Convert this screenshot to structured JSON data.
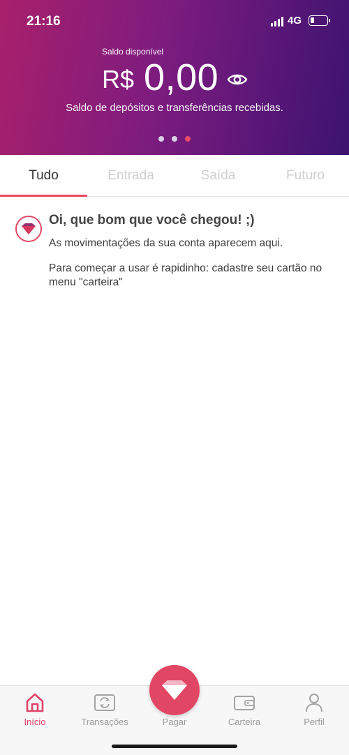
{
  "status_bar": {
    "time": "21:16",
    "network": "4G"
  },
  "balance": {
    "label": "Saldo disponível",
    "currency": "R$",
    "value": "0,00",
    "description": "Saldo de depósitos e transferências recebidas.",
    "page_count": 3,
    "active_page": 3
  },
  "tabs": [
    {
      "label": "Tudo",
      "active": true
    },
    {
      "label": "Entrada",
      "active": false
    },
    {
      "label": "Saída",
      "active": false
    },
    {
      "label": "Futuro",
      "active": false
    }
  ],
  "welcome": {
    "title": "Oi, que bom que você chegou! ;)",
    "line1": "As movimentações da sua conta aparecem aqui.",
    "line2": "Para começar a usar é rapidinho: cadastre seu cartão no menu \"carteira\""
  },
  "bottom_nav": {
    "items": [
      {
        "label": "Início",
        "icon": "home-icon",
        "active": true
      },
      {
        "label": "Transações",
        "icon": "transactions-icon",
        "active": false
      },
      {
        "label": "Pagar",
        "icon": "heart-pay-icon",
        "active": false
      },
      {
        "label": "Carteira",
        "icon": "wallet-icon",
        "active": false
      },
      {
        "label": "Perfil",
        "icon": "profile-icon",
        "active": false
      }
    ]
  },
  "colors": {
    "accent": "#e24665",
    "header_gradient_start": "#a8206a",
    "header_gradient_end": "#3c1370"
  }
}
